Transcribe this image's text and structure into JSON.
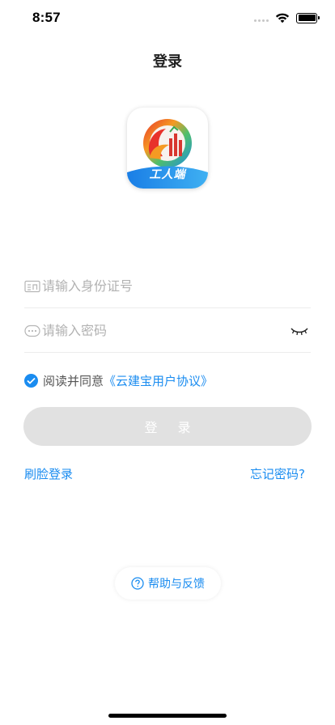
{
  "status_bar": {
    "time": "8:57"
  },
  "header": {
    "title": "登录"
  },
  "logo": {
    "label": "工人端"
  },
  "form": {
    "id_placeholder": "请输入身份证号",
    "password_placeholder": "请输入密码"
  },
  "agreement": {
    "prefix": "阅读并同意",
    "link": "《云建宝用户协议》",
    "checked": true
  },
  "actions": {
    "login_label": "登 录",
    "face_login_label": "刷脸登录",
    "forgot_password_label": "忘记密码?",
    "help_label": "帮助与反馈"
  },
  "colors": {
    "accent": "#1a8cf0",
    "button_disabled": "#e1e1e1",
    "placeholder": "#b2b2b2"
  },
  "icons": [
    "signal-icon",
    "wifi-icon",
    "battery-icon",
    "id-card-icon",
    "password-dots-icon",
    "eye-closed-icon",
    "checkmark-icon",
    "question-circle-icon"
  ]
}
